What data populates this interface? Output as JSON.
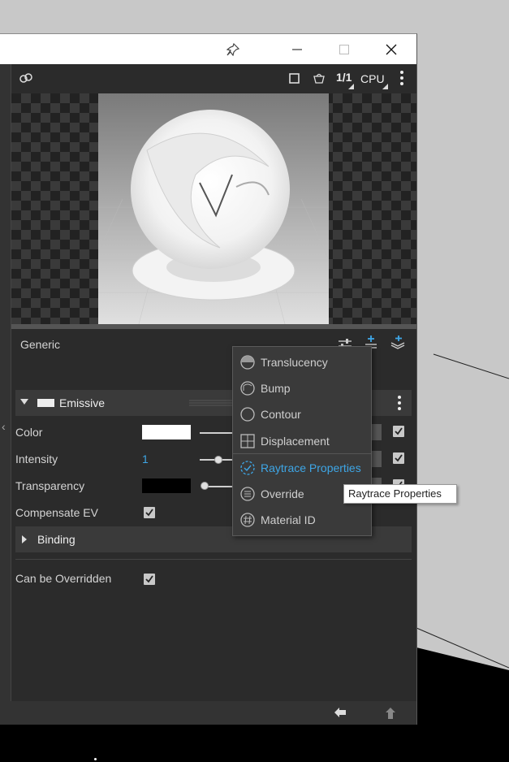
{
  "toolbar": {
    "ratio_label": "1/1",
    "engine_label": "CPU"
  },
  "panel": {
    "title": "Generic",
    "section": {
      "label": "Emissive"
    },
    "rows": [
      {
        "label": "Color"
      },
      {
        "label": "Intensity",
        "value": "1"
      },
      {
        "label": "Transparency"
      },
      {
        "label": "Compensate EV"
      }
    ],
    "binding": {
      "label": "Binding"
    },
    "override": {
      "label": "Can be Overridden"
    }
  },
  "menu": {
    "items": [
      {
        "label": "Translucency"
      },
      {
        "label": "Bump"
      },
      {
        "label": "Contour"
      },
      {
        "label": "Displacement"
      },
      {
        "label": "Raytrace Properties",
        "active": true
      },
      {
        "label": "Override"
      },
      {
        "label": "Material ID"
      }
    ]
  },
  "tooltip": {
    "text": "Raytrace Properties"
  },
  "colors": {
    "accent": "#3ea6e6",
    "panel": "#2b2b2b",
    "section": "#3a3a3a"
  }
}
